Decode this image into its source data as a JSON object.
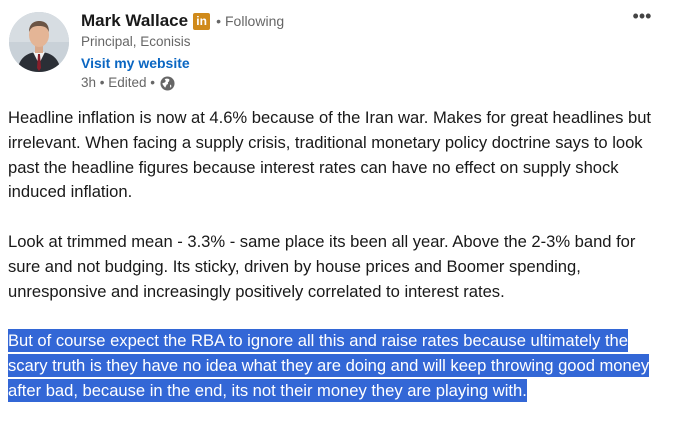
{
  "author": {
    "name": "Mark Wallace",
    "badge": "in",
    "separator": "•",
    "follow_status": "Following",
    "headline": "Principal, Econisis",
    "website_link": "Visit my website",
    "meta": "3h • Edited •"
  },
  "menu": {
    "more_label": "•••"
  },
  "post": {
    "paragraphs": [
      "Headline inflation is now at 4.6% because of the Iran war. Makes for great headlines but irrelevant. When facing a supply crisis, traditional monetary policy doctrine says to look past the headline figures because interest rates can have no effect on supply shock induced inflation.",
      "Look at trimmed mean - 3.3% - same place its been all year. Above the 2-3% band for sure and not budging. Its sticky, driven by house prices and Boomer spending, unresponsive and increasingly positively correlated to interest rates.",
      "But of course expect the RBA to ignore all this and raise rates because ultimately the scary truth is they have no idea what they are doing and will keep throwing good money after bad, because in the end, its not their money they are playing with."
    ]
  },
  "colors": {
    "link": "#0a66c2",
    "badge": "#d08a1a",
    "selection": "#3367d6"
  }
}
